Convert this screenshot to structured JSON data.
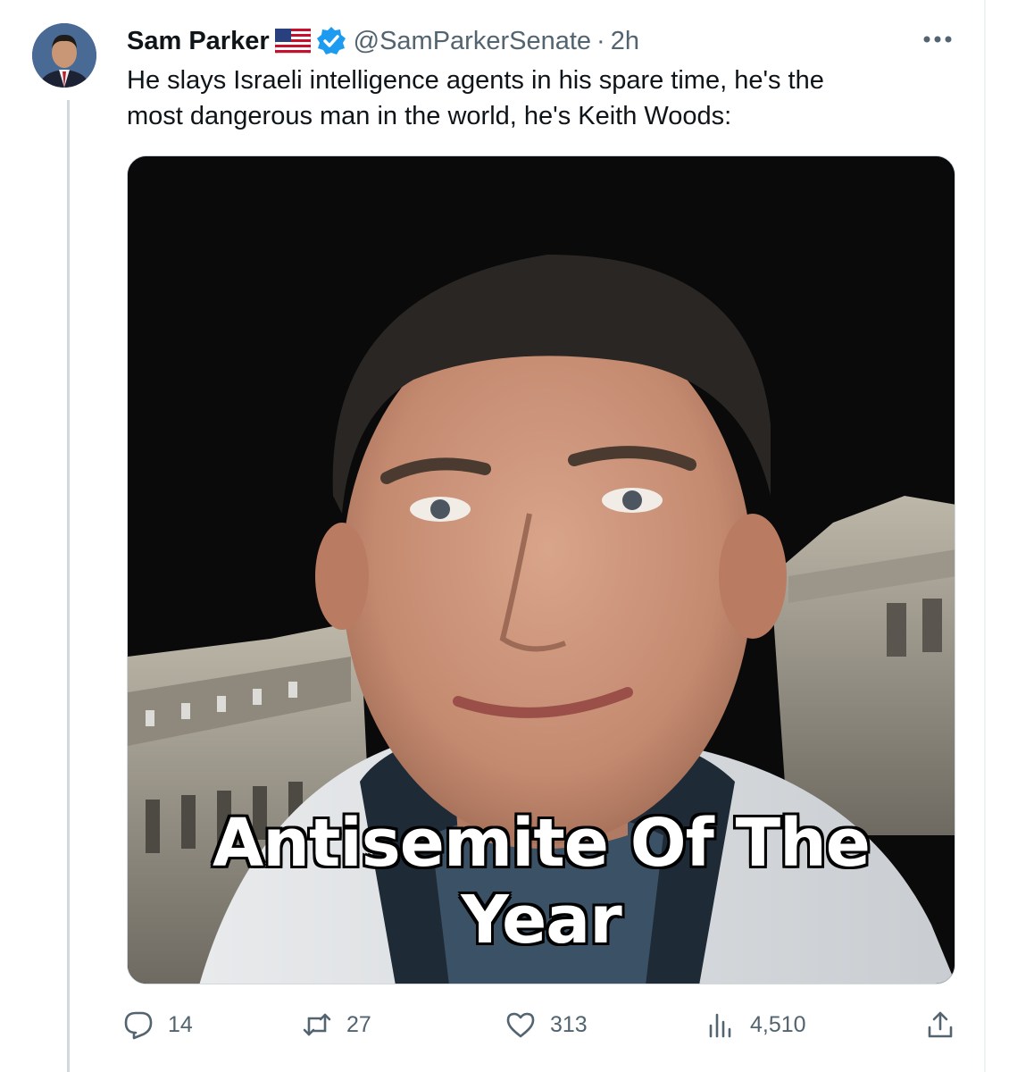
{
  "tweet": {
    "author_name": "Sam Parker",
    "handle": "@SamParkerSenate",
    "separator": "·",
    "time": "2h",
    "text": "He slays Israeli intelligence agents in his spare time, he's the\nmost dangerous man in the world, he's Keith Woods:",
    "media_caption": "Antisemite Of The Year"
  },
  "actions": {
    "replies": "14",
    "retweets": "27",
    "likes": "313",
    "views": "4,510"
  },
  "icons": {
    "avatar": "profile-photo",
    "flag": "us-flag-icon",
    "verified": "verified-badge-icon",
    "more": "more-options-icon",
    "reply": "reply-icon",
    "retweet": "retweet-icon",
    "like": "heart-icon",
    "views": "views-chart-icon",
    "share": "share-icon"
  },
  "colors": {
    "text": "#0f1419",
    "secondary": "#536471",
    "verified": "#1d9bf0",
    "border": "#cfd9de"
  }
}
